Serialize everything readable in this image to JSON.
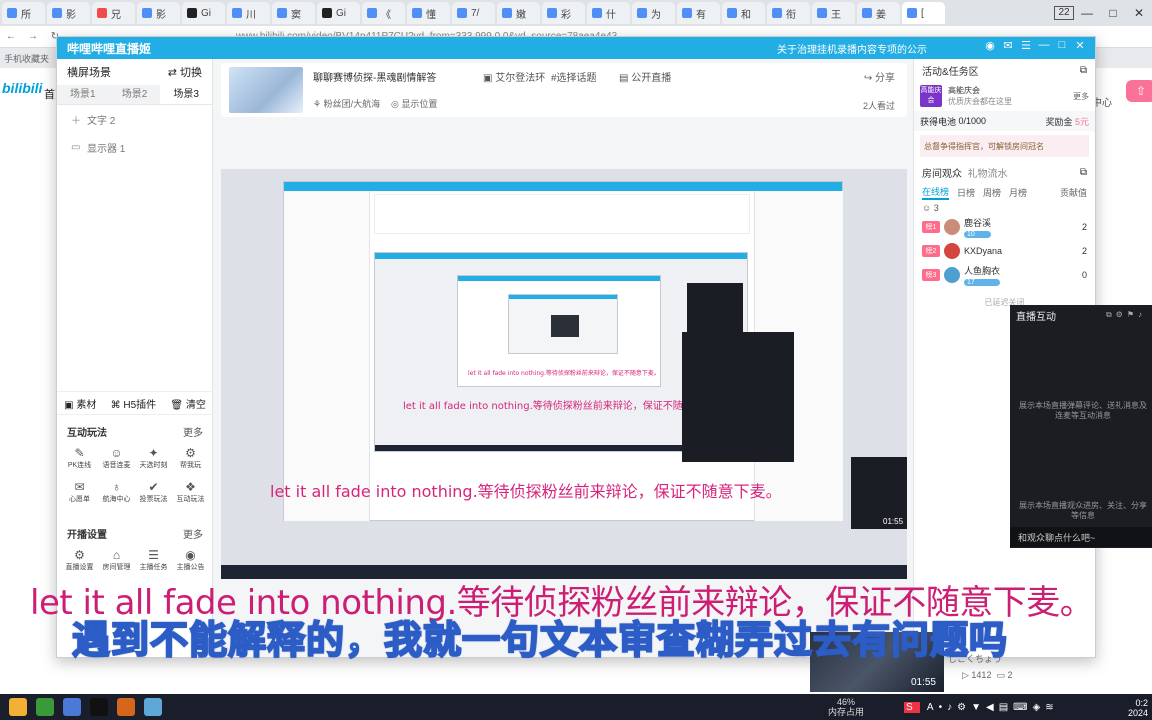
{
  "browser": {
    "tabs": [
      {
        "label": "所",
        "color": "#4f8ff7"
      },
      {
        "label": "影",
        "color": "#4f8ff7"
      },
      {
        "label": "兄",
        "color": "#f04c4c"
      },
      {
        "label": "影",
        "color": "#4f8ff7"
      },
      {
        "label": "Gi",
        "color": "#222222"
      },
      {
        "label": "川",
        "color": "#4f8ff7"
      },
      {
        "label": "窦",
        "color": "#4f8ff7"
      },
      {
        "label": "Gi",
        "color": "#222222"
      },
      {
        "label": "《",
        "color": "#4f8ff7"
      },
      {
        "label": "懂",
        "color": "#4f8ff7"
      },
      {
        "label": "7/",
        "color": "#4f8ff7"
      },
      {
        "label": "嫩",
        "color": "#4f8ff7"
      },
      {
        "label": "彩",
        "color": "#4f8ff7"
      },
      {
        "label": "什",
        "color": "#4f8ff7"
      },
      {
        "label": "为",
        "color": "#4f8ff7"
      },
      {
        "label": "有",
        "color": "#4f8ff7"
      },
      {
        "label": "和",
        "color": "#4f8ff7"
      },
      {
        "label": "衔",
        "color": "#4f8ff7"
      },
      {
        "label": "王",
        "color": "#4f8ff7"
      },
      {
        "label": "姜",
        "color": "#4f8ff7"
      },
      {
        "label": "[",
        "color": "#4f8ff7"
      }
    ],
    "url": "www.bilibili.com/video/BV14p411P7CU?vd_from=333.999.0.0&vd_source=78aea4e43",
    "tab_count": "22",
    "window_controls": [
      "—",
      "□",
      "✕"
    ]
  },
  "bilibili": {
    "logo": "bilibili",
    "nav_home": "首页",
    "nav_center": "中心",
    "bookmark": "手机收藏夹"
  },
  "studio": {
    "title": "哔哩哔哩直播姬",
    "notice": "关于治理挂机录播内容专项的公示",
    "left": {
      "scene_header": "横屏场景",
      "switch_label": "切换",
      "scene_tabs": [
        "场景1",
        "场景2",
        "场景3"
      ],
      "sources": [
        {
          "icon": "＋",
          "label": "文字 2"
        },
        {
          "icon": "▭",
          "label": "显示器 1"
        }
      ],
      "toolbar": [
        "素材",
        "H5插件",
        "清空"
      ],
      "interact_title": "互动玩法",
      "interact_more": "更多",
      "interact_tools": [
        {
          "icon": "✎",
          "label": "PK连线"
        },
        {
          "icon": "☺",
          "label": "语音连麦"
        },
        {
          "icon": "✦",
          "label": "天选时刻"
        },
        {
          "icon": "⚙",
          "label": "帮我玩"
        },
        {
          "icon": "✉",
          "label": "心愿单"
        },
        {
          "icon": "♁",
          "label": "航海中心"
        },
        {
          "icon": "✔",
          "label": "投票玩法"
        },
        {
          "icon": "❖",
          "label": "互动玩法"
        }
      ],
      "settings_title": "开播设置",
      "settings_more": "更多",
      "settings_tools": [
        {
          "icon": "⚙",
          "label": "直播设置"
        },
        {
          "icon": "⌂",
          "label": "房间管理"
        },
        {
          "icon": "☰",
          "label": "主播任务"
        },
        {
          "icon": "◉",
          "label": "主播公告"
        }
      ]
    },
    "room": {
      "title": "聊聊赛博侦探-黑魂剧情解答",
      "tags": [
        "艾尔登法环",
        "#选择话题",
        "公开直播"
      ],
      "share": "分享",
      "fans": "粉丝团/大航海",
      "show_position": "显示位置",
      "viewed": "2人看过"
    },
    "preview": {
      "subtitle_nested_1": "let it all fade into nothing.等待侦探粉丝前来辩论，保证不随意下麦。",
      "subtitle_nested_2": "let it all fade into nothing.等待侦探粉丝前来辩论，保证不随意下麦。",
      "subtitle_nested_3": "let it all fade into nothing.等待侦探粉丝前来辩论，保证不随意下麦。",
      "overlay_time": "01:55"
    },
    "right": {
      "activity_title": "活动&任务区",
      "activity_badge": "高能庆会",
      "activity_name": "高能庆会",
      "activity_desc": "优质庆会都在这里",
      "activity_more": "更多",
      "battery_label": "获得电池",
      "battery_value": "0/1000",
      "reward_label": "奖励金",
      "reward_value": "5元",
      "commander_text": "总督争得指挥官，可解锁房间冠名",
      "audience_title": "房间观众",
      "gift_stream": "礼物流水",
      "audience_tabs": [
        "在线榜",
        "日榜",
        "周榜",
        "月榜"
      ],
      "contribution": "贡献值",
      "online_count": "3",
      "viewers": [
        {
          "rank": "榜1",
          "name": "鹿谷溪",
          "level": "10",
          "count": "2",
          "avatar": "#c98b7a"
        },
        {
          "rank": "榜2",
          "name": "KXDyana",
          "level": "",
          "count": "2",
          "avatar": "#d3453f"
        },
        {
          "rank": "榜3",
          "name": "人鱼胸衣",
          "level": "17",
          "count": "0",
          "avatar": "#4f9fd1"
        }
      ],
      "closed_label": "已延迟关闭"
    }
  },
  "interact_panel": {
    "title": "直播互动",
    "desc1": "展示本场直播弹幕评论、送礼消息及连麦等互动消息",
    "desc2": "展示本场直播观众进房、关注、分享等信息",
    "input_placeholder": "和观众聊点什么吧~"
  },
  "video": {
    "time": "01:55",
    "uploader": "じこくちょう",
    "views": "1412",
    "comments": "2"
  },
  "subtitles": {
    "english": "let it all fade into nothing.等待侦探粉丝前来辩论，保证不随意下麦。",
    "chinese": "遇到不能解释的，我就一句文本审查糊弄过去有问题吗"
  },
  "taskbar": {
    "icons": [
      "#f2b134",
      "#3a9a3a",
      "#4a79d8",
      "#111111",
      "#d5661c",
      "#5ea8d7"
    ],
    "memory_pct": "46%",
    "memory_label": "内存占用",
    "clock_time": "0:2",
    "clock_date": "2024",
    "ime": "S"
  }
}
